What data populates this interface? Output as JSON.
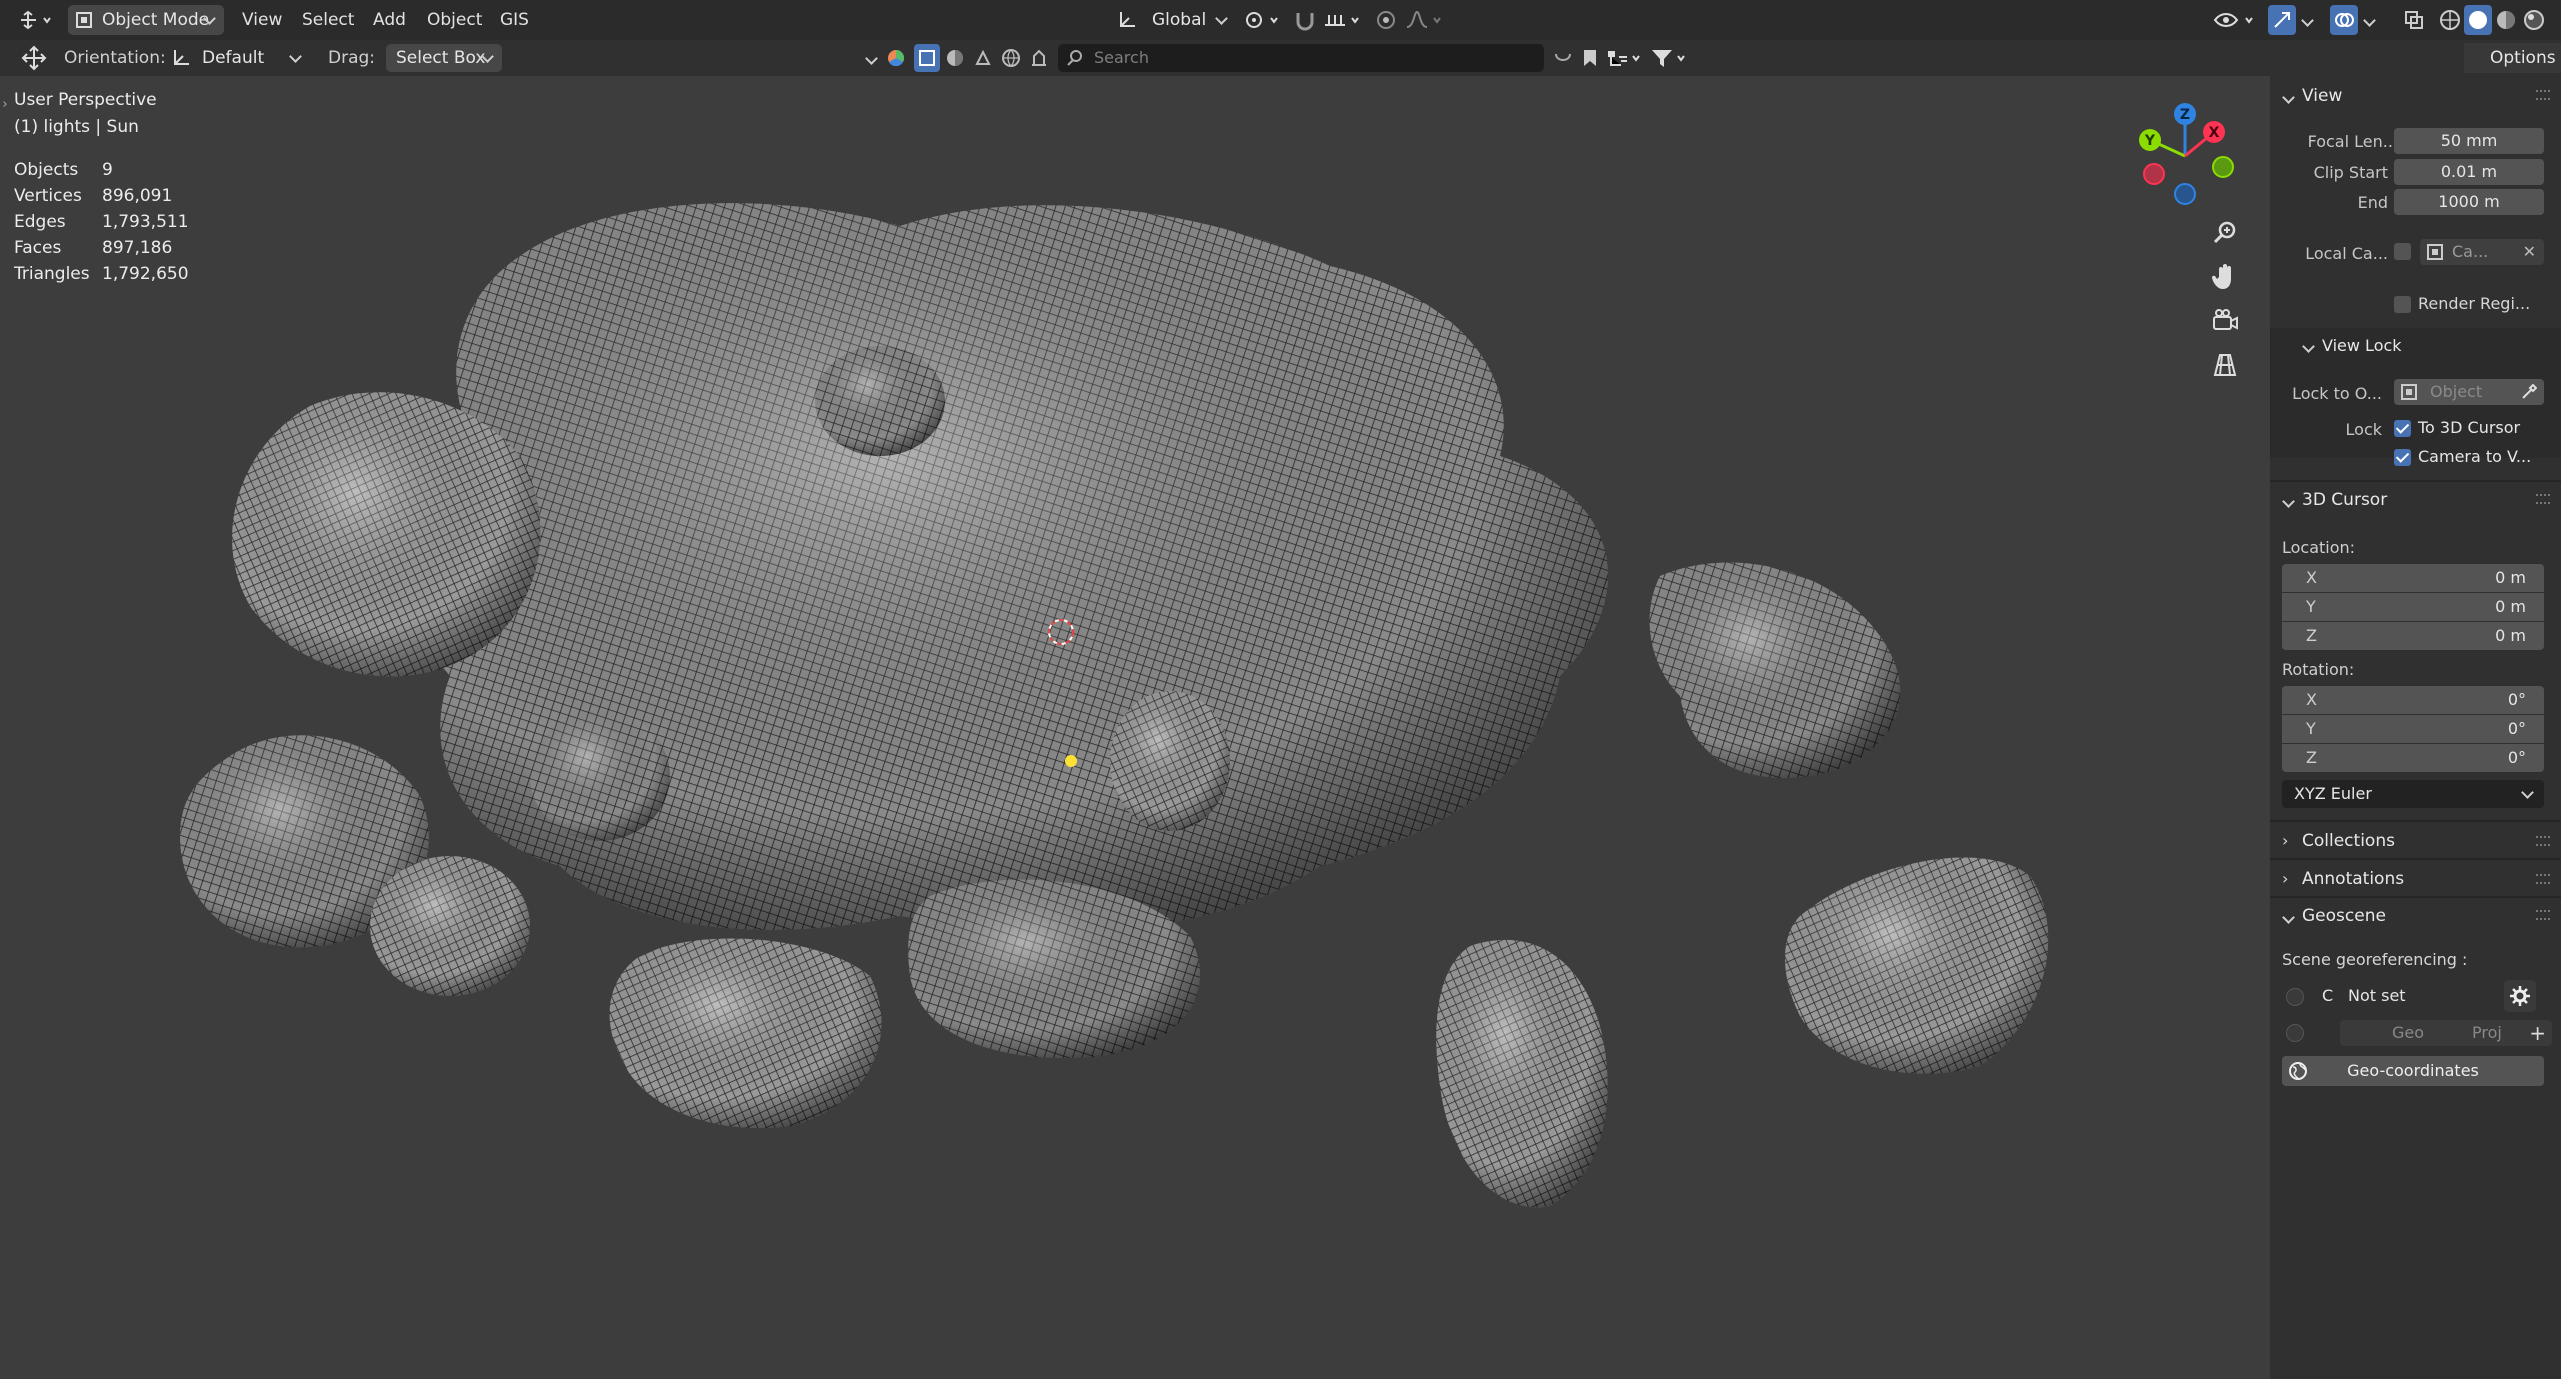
{
  "header": {
    "mode": "Object Mode",
    "menus": [
      "View",
      "Select",
      "Add",
      "Object",
      "GIS"
    ],
    "transform_orientation": "Global",
    "options_label": "Options",
    "search_placeholder": "Search"
  },
  "toolbar": {
    "orientation_label": "Orientation:",
    "orientation_value": "Default",
    "drag_label": "Drag:",
    "drag_value": "Select Box"
  },
  "viewport": {
    "view_name": "User Perspective",
    "context": "(1) lights | Sun",
    "stats": [
      {
        "label": "Objects",
        "value": "9"
      },
      {
        "label": "Vertices",
        "value": "896,091"
      },
      {
        "label": "Edges",
        "value": "1,793,511"
      },
      {
        "label": "Faces",
        "value": "897,186"
      },
      {
        "label": "Triangles",
        "value": "1,792,650"
      }
    ],
    "gizmo": {
      "z": "Z",
      "y": "Y",
      "x": "X",
      "z_color": "#2f84e3",
      "y_color": "#8bdc00",
      "x_color": "#ff3352"
    }
  },
  "sidebar": {
    "view": {
      "title": "View",
      "focal_label": "Focal Len...",
      "focal_value": "50 mm",
      "clip_start_label": "Clip Start",
      "clip_start_value": "0.01 m",
      "end_label": "End",
      "end_value": "1000 m",
      "local_camera_label": "Local Ca...",
      "local_camera_value": "Ca...",
      "render_region_label": "Render Regi..."
    },
    "view_lock": {
      "title": "View Lock",
      "lock_to_label": "Lock to O...",
      "lock_to_placeholder": "Object",
      "lock_label": "Lock",
      "to_cursor_label": "To 3D Cursor",
      "camera_to_view_label": "Camera to V..."
    },
    "cursor": {
      "title": "3D Cursor",
      "location_label": "Location:",
      "location": [
        {
          "axis": "X",
          "value": "0 m"
        },
        {
          "axis": "Y",
          "value": "0 m"
        },
        {
          "axis": "Z",
          "value": "0 m"
        }
      ],
      "rotation_label": "Rotation:",
      "rotation": [
        {
          "axis": "X",
          "value": "0°"
        },
        {
          "axis": "Y",
          "value": "0°"
        },
        {
          "axis": "Z",
          "value": "0°"
        }
      ],
      "rotation_mode": "XYZ Euler"
    },
    "collections_title": "Collections",
    "annotations_title": "Annotations",
    "geoscene": {
      "title": "Geoscene",
      "georef_label": "Scene georeferencing :",
      "crs_letter": "C",
      "not_set": "Not set",
      "geo_label": "Geo",
      "proj_label": "Proj",
      "geo_coordinates_button": "Geo-coordinates"
    }
  }
}
